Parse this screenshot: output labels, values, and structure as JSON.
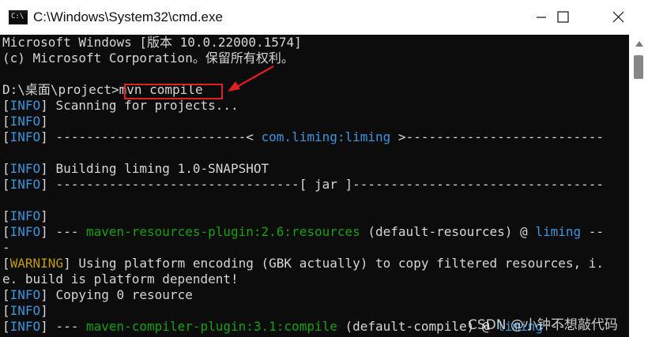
{
  "window": {
    "title": "C:\\Windows\\System32\\cmd.exe",
    "icon": "cmd-prompt-icon",
    "icon_glyph": "C:\\",
    "controls": [
      "minimize-icon",
      "maximize-icon",
      "close-icon"
    ]
  },
  "colors": {
    "background": "#0c0c0c",
    "text": "#d6d6d6",
    "info": "#3a96dd",
    "warning": "#c19c00",
    "plugin": "#13a10e",
    "annotation": "#e02020"
  },
  "console": {
    "lines": [
      [
        {
          "t": "Microsoft Windows [版本 10.0.22000.1574]",
          "c": "default"
        }
      ],
      [
        {
          "t": "(c) Microsoft Corporation。保留所有权利。",
          "c": "default"
        }
      ],
      [
        {
          "t": "",
          "c": "default"
        }
      ],
      [
        {
          "t": "D:\\桌面\\project>",
          "c": "default"
        },
        {
          "t": "mvn compile",
          "c": "default"
        }
      ],
      [
        {
          "t": "[",
          "c": "default"
        },
        {
          "t": "INFO",
          "c": "info"
        },
        {
          "t": "] Scanning for projects...",
          "c": "default"
        }
      ],
      [
        {
          "t": "[",
          "c": "default"
        },
        {
          "t": "INFO",
          "c": "info"
        },
        {
          "t": "]",
          "c": "default"
        }
      ],
      [
        {
          "t": "[",
          "c": "default"
        },
        {
          "t": "INFO",
          "c": "info"
        },
        {
          "t": "] -------------------------< ",
          "c": "default"
        },
        {
          "t": "com.liming:liming",
          "c": "cyan"
        },
        {
          "t": " >--------------------------",
          "c": "default"
        }
      ],
      [
        {
          "t": "",
          "c": "default"
        }
      ],
      [
        {
          "t": "[",
          "c": "default"
        },
        {
          "t": "INFO",
          "c": "info"
        },
        {
          "t": "] Building liming 1.0-SNAPSHOT",
          "c": "default"
        }
      ],
      [
        {
          "t": "[",
          "c": "default"
        },
        {
          "t": "INFO",
          "c": "info"
        },
        {
          "t": "] --------------------------------[ jar ]---------------------------------",
          "c": "default"
        }
      ],
      [
        {
          "t": "",
          "c": "default"
        }
      ],
      [
        {
          "t": "[",
          "c": "default"
        },
        {
          "t": "INFO",
          "c": "info"
        },
        {
          "t": "]",
          "c": "default"
        }
      ],
      [
        {
          "t": "[",
          "c": "default"
        },
        {
          "t": "INFO",
          "c": "info"
        },
        {
          "t": "] --- ",
          "c": "default"
        },
        {
          "t": "maven-resources-plugin:2.6:resources",
          "c": "green"
        },
        {
          "t": " (default-resources) @ ",
          "c": "default"
        },
        {
          "t": "liming",
          "c": "cyan"
        },
        {
          "t": " --",
          "c": "default"
        }
      ],
      [
        {
          "t": "-",
          "c": "default"
        }
      ],
      [
        {
          "t": "[",
          "c": "default"
        },
        {
          "t": "WARNING",
          "c": "warn"
        },
        {
          "t": "] Using platform encoding (GBK actually) to copy filtered resources, i.",
          "c": "default"
        }
      ],
      [
        {
          "t": "e. build is platform dependent!",
          "c": "default"
        }
      ],
      [
        {
          "t": "[",
          "c": "default"
        },
        {
          "t": "INFO",
          "c": "info"
        },
        {
          "t": "] Copying 0 resource",
          "c": "default"
        }
      ],
      [
        {
          "t": "[",
          "c": "default"
        },
        {
          "t": "INFO",
          "c": "info"
        },
        {
          "t": "]",
          "c": "default"
        }
      ],
      [
        {
          "t": "[",
          "c": "default"
        },
        {
          "t": "INFO",
          "c": "info"
        },
        {
          "t": "] --- ",
          "c": "default"
        },
        {
          "t": "maven-compiler-plugin:3.1:compile",
          "c": "green"
        },
        {
          "t": " (default-compile) @ ",
          "c": "default"
        },
        {
          "t": "liming",
          "c": "cyan"
        },
        {
          "t": " ---",
          "c": "default"
        }
      ]
    ]
  },
  "annotation": {
    "highlighted_command": "mvn compile",
    "arrow_icon": "arrow-pointer-icon"
  },
  "watermark": {
    "text": "CSDN @小钟不想敲代码"
  }
}
